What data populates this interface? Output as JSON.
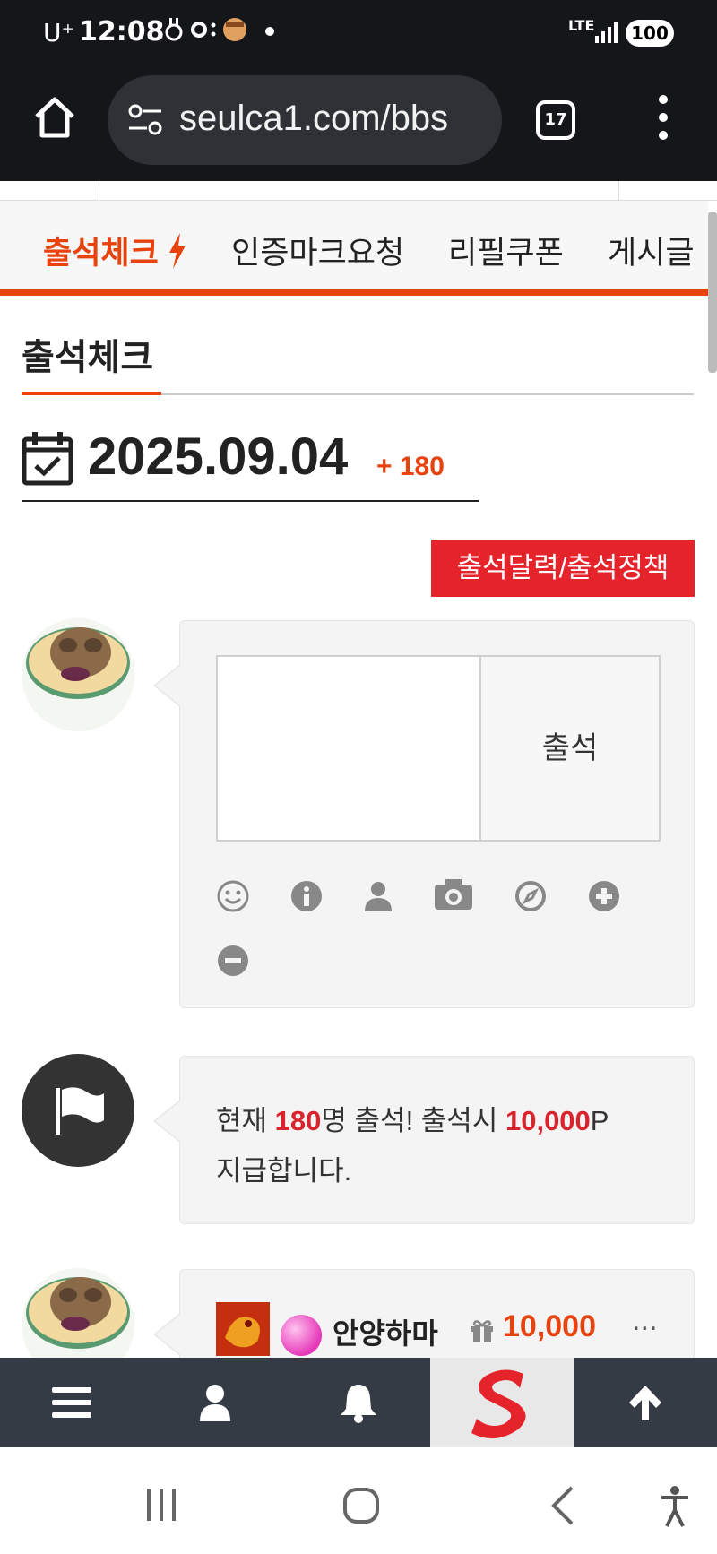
{
  "status_bar": {
    "carrier": "U⁺",
    "time": "12:08",
    "lte": "LTE",
    "battery": "100"
  },
  "browser": {
    "url": "seulca1.com/bbs",
    "tab_count": "17"
  },
  "category_tabs": [
    {
      "label": "출석체크",
      "active": true
    },
    {
      "label": "인증마크요청",
      "active": false
    },
    {
      "label": "리필쿠폰",
      "active": false
    },
    {
      "label": "게시글",
      "active": false
    }
  ],
  "page": {
    "title": "출석체크",
    "date": "2025.09.04",
    "attend_count": "+ 180",
    "policy_button": "출석달력/출석정책"
  },
  "comment_form": {
    "textarea_value": "",
    "submit_label": "출석",
    "toolbar_icons": [
      "smile-icon",
      "info-icon",
      "user-icon",
      "camera-icon",
      "compass-icon",
      "plus-icon",
      "minus-icon"
    ]
  },
  "notice": {
    "prefix": "현재 ",
    "count": "180",
    "middle": "명 출석! 출석시 ",
    "points": "10,000",
    "suffix": "P",
    "line2": "지급합니다."
  },
  "entry": {
    "name": "안양하마",
    "points": "10,000",
    "more": "..."
  },
  "colors": {
    "accent": "#e8420d",
    "red_button": "#e5232b",
    "bottom_nav": "#343b44"
  }
}
